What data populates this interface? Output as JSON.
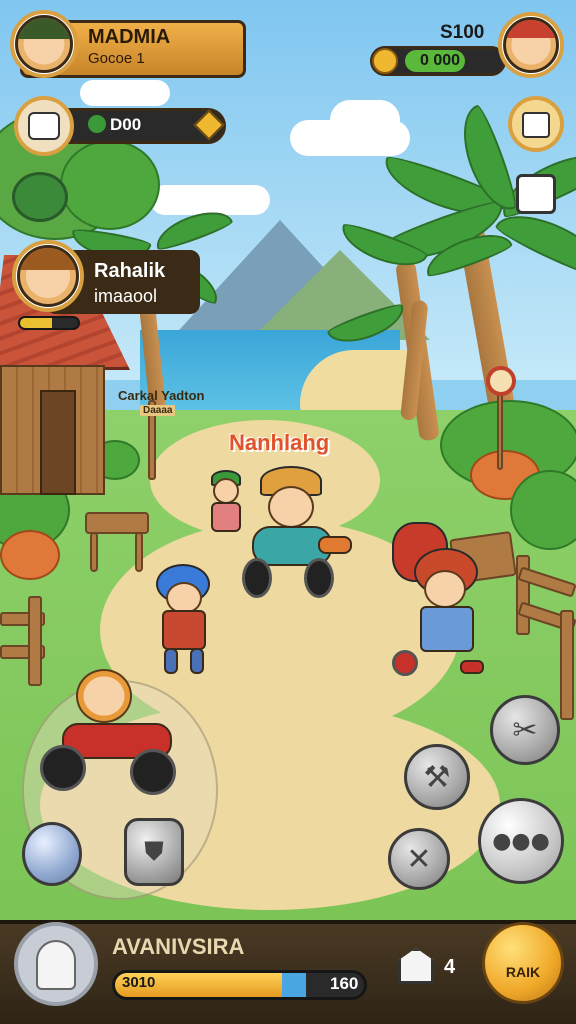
{
  "player_top_left": {
    "name": "MADMIA",
    "subtitle": "Gocoe 1"
  },
  "top_right": {
    "currency_value": "S100",
    "coin_value": "0 000"
  },
  "resource_panel": {
    "value": "D00"
  },
  "npc_card": {
    "name": "Rahalik",
    "subtitle": "imaaool",
    "progress": 0.55
  },
  "world_labels": {
    "sign_title": "Carkal Yadton",
    "sign_sub": "Daaaa",
    "zone_name": "Nanhlahg"
  },
  "bottom_bar": {
    "player_name": "AVANIVSIRA",
    "xp_left": "3010",
    "xp_right": "160",
    "xp_fraction": 0.72,
    "inventory_count": "4",
    "rank_label": "RAIK"
  },
  "icons": {
    "top_left_avatar": "boy-avatar",
    "top_right_avatar": "girl-avatar",
    "resource_icon": "cat-mask-icon",
    "gem_icon": "diamond-icon",
    "clover_icon": "clover-icon",
    "shop_icon": "shop-bag-icon",
    "quest_icon": "notice-board-icon",
    "action_1": "tools-icon",
    "action_2": "wrench-icon",
    "action_3": "cancel-icon",
    "action_4": "more-dots-icon",
    "joystick_a": "circle-button-icon",
    "joystick_b": "shield-button-icon",
    "bottom_avatar": "profile-silhouette-icon",
    "inventory": "house-key-icon"
  },
  "colors": {
    "hud_gold": "#d8a040",
    "hud_dark": "#2e2416",
    "xp_fill": "#f0a828",
    "zone_text": "#e0522c"
  }
}
